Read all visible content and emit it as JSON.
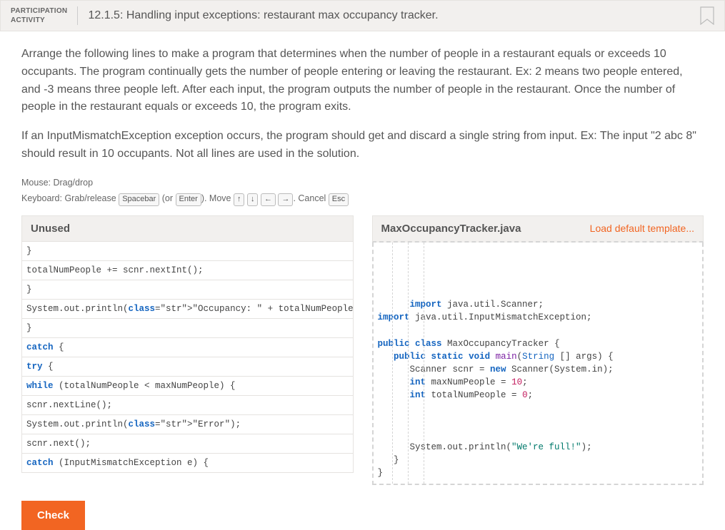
{
  "header": {
    "label_line1": "PARTICIPATION",
    "label_line2": "ACTIVITY",
    "title": "12.1.5: Handling input exceptions: restaurant max occupancy tracker."
  },
  "instructions": {
    "p1": "Arrange the following lines to make a program that determines when the number of people in a restaurant equals or exceeds 10 occupants. The program continually gets the number of people entering or leaving the restaurant. Ex: 2 means two people entered, and -3 means three people left. After each input, the program outputs the number of people in the restaurant. Once the number of people in the restaurant equals or exceeds 10, the program exits.",
    "p2": "If an InputMismatchException exception occurs, the program should get and discard a single string from input. Ex: The input \"2 abc 8\" should result in 10 occupants. Not all lines are used in the solution."
  },
  "hints": {
    "mouse": "Mouse: Drag/drop",
    "kb_prefix": "Keyboard: Grab/release ",
    "kb_or": " (or ",
    "kb_move": "). Move ",
    "kb_cancel": ". Cancel ",
    "key_spacebar": "Spacebar",
    "key_enter": "Enter",
    "key_up": "↑",
    "key_down": "↓",
    "key_left": "←",
    "key_right": "→",
    "key_esc": "Esc"
  },
  "unused": {
    "title": "Unused",
    "items": [
      "}",
      "totalNumPeople += scnr.nextInt();",
      "}",
      "System.out.println(\"Occupancy: \" + totalNumPeople);",
      "}",
      "catch {",
      "try {",
      "while (totalNumPeople < maxNumPeople) {",
      "scnr.nextLine();",
      "System.out.println(\"Error\");",
      "scnr.next();",
      "catch (InputMismatchException e) {"
    ]
  },
  "editor": {
    "title": "MaxOccupancyTracker.java",
    "load_link": "Load default template...",
    "tokens": [
      {
        "t": "import",
        "c": "kw"
      },
      {
        "t": " java.util.Scanner;\n"
      },
      {
        "t": "import",
        "c": "kw"
      },
      {
        "t": " java.util.InputMismatchException;\n"
      },
      {
        "t": "\n"
      },
      {
        "t": "public",
        "c": "kw"
      },
      {
        "t": " "
      },
      {
        "t": "class",
        "c": "kw"
      },
      {
        "t": " MaxOccupancyTracker {\n"
      },
      {
        "t": "   "
      },
      {
        "t": "public",
        "c": "kw"
      },
      {
        "t": " "
      },
      {
        "t": "static",
        "c": "kw"
      },
      {
        "t": " "
      },
      {
        "t": "void",
        "c": "kw"
      },
      {
        "t": " "
      },
      {
        "t": "main",
        "c": "method"
      },
      {
        "t": "("
      },
      {
        "t": "String",
        "c": "type"
      },
      {
        "t": " [] args) {\n"
      },
      {
        "t": "      Scanner scnr = "
      },
      {
        "t": "new",
        "c": "kw"
      },
      {
        "t": " Scanner(System.in);\n"
      },
      {
        "t": "      "
      },
      {
        "t": "int",
        "c": "kw"
      },
      {
        "t": " maxNumPeople = "
      },
      {
        "t": "10",
        "c": "num"
      },
      {
        "t": ";\n"
      },
      {
        "t": "      "
      },
      {
        "t": "int",
        "c": "kw"
      },
      {
        "t": " totalNumPeople = "
      },
      {
        "t": "0",
        "c": "num"
      },
      {
        "t": ";\n"
      },
      {
        "t": "\n"
      },
      {
        "t": "\n"
      },
      {
        "t": "\n"
      },
      {
        "t": "      System.out.println("
      },
      {
        "t": "\"We're full!\"",
        "c": "str"
      },
      {
        "t": ");\n"
      },
      {
        "t": "   }\n"
      },
      {
        "t": "}\n"
      }
    ]
  },
  "check_label": "Check"
}
